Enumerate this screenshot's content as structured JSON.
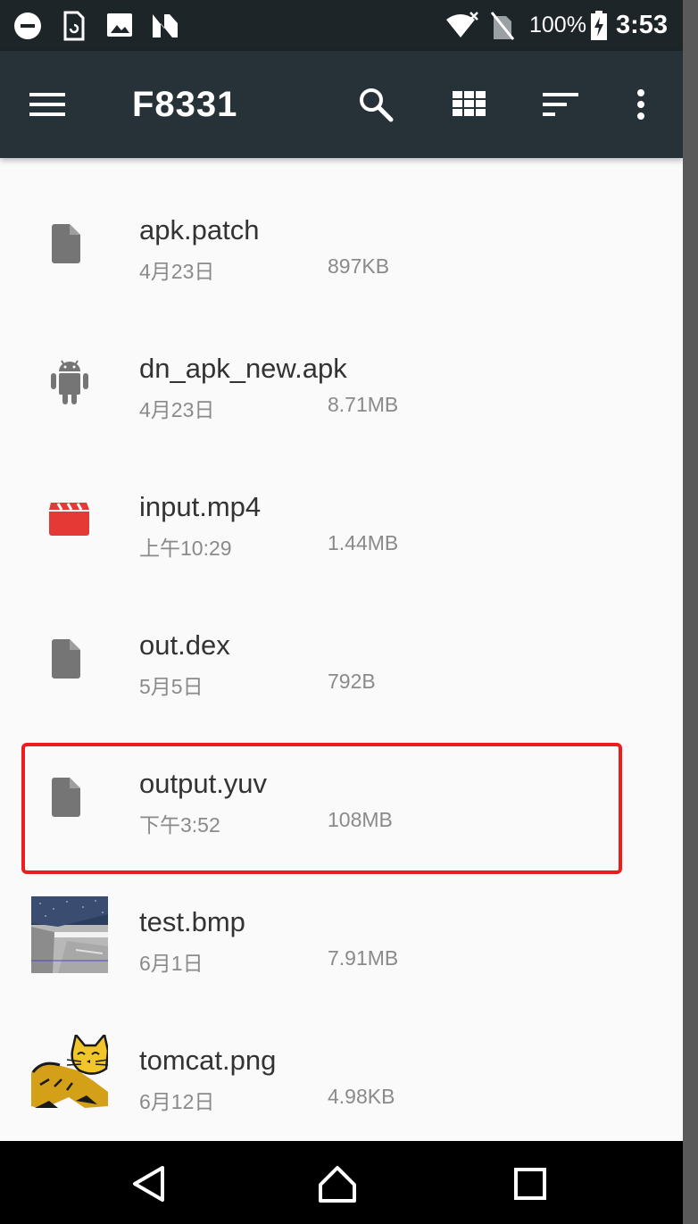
{
  "status_bar": {
    "icons": [
      "do-not-disturb-icon",
      "sim-refresh-icon",
      "image-icon",
      "n-app-icon",
      "wifi-icon",
      "no-sim-icon",
      "battery-charging-icon"
    ],
    "battery": "100%",
    "time": "3:53"
  },
  "app_bar": {
    "menu_icon": "hamburger-menu-icon",
    "title": "F8331",
    "actions": [
      "search-icon",
      "grid-view-icon",
      "sort-icon",
      "more-vert-icon"
    ]
  },
  "files": [
    {
      "name": "apk.patch",
      "date": "4月23日",
      "size": "897KB",
      "icon": "document-icon"
    },
    {
      "name": "dn_apk_new.apk",
      "date": "4月23日",
      "size": "8.71MB",
      "icon": "android-icon"
    },
    {
      "name": "input.mp4",
      "date": "上午10:29",
      "size": "1.44MB",
      "icon": "video-clapper-icon",
      "icon_color": "#e53935"
    },
    {
      "name": "out.dex",
      "date": "5月5日",
      "size": "792B",
      "icon": "document-icon"
    },
    {
      "name": "output.yuv",
      "date": "下午3:52",
      "size": "108MB",
      "icon": "document-icon",
      "highlighted": true
    },
    {
      "name": "test.bmp",
      "date": "6月1日",
      "size": "7.91MB",
      "icon": "image-thumbnail"
    },
    {
      "name": "tomcat.png",
      "date": "6月12日",
      "size": "4.98KB",
      "icon": "tomcat-thumbnail"
    }
  ],
  "highlight_color": "#ee1c1c",
  "nav_bar": {
    "buttons": [
      "back-icon",
      "home-icon",
      "recents-icon"
    ]
  }
}
